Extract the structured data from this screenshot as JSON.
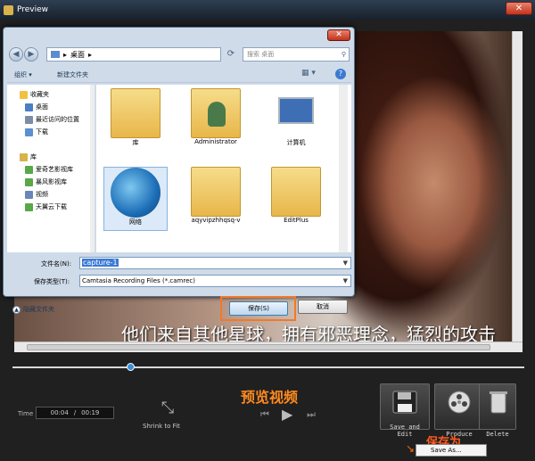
{
  "window": {
    "title": "Preview",
    "close": "✕"
  },
  "video": {
    "subtitle": "他们来自其他星球，拥有邪恶理念，猛烈的攻击"
  },
  "controls": {
    "time_label": "Time",
    "time_current": "00:04",
    "time_sep": "/",
    "time_total": "00:19",
    "shrink_label": "Shrink to Fit",
    "preview_caption": "预览视频",
    "seek_fraction": 0.23
  },
  "actions": {
    "save_edit": "Save and Edit",
    "produce": "Produce",
    "delete": "Delete",
    "save_as_menu": "Save As...",
    "save_as_caption": "保存为"
  },
  "dialog": {
    "address": "桌面",
    "search_placeholder": "搜索 桌面",
    "organize": "组织 ▾",
    "new_folder": "新建文件夹",
    "nav": {
      "favorites": "收藏夹",
      "desktop": "桌面",
      "recent": "最近访问的位置",
      "downloads": "下载",
      "libraries": "库",
      "lib1": "爱奇艺影视库",
      "lib2": "暴风影视库",
      "videos": "视频",
      "tianyi": "天翼云下载"
    },
    "files": {
      "f1": "库",
      "f2": "Administrator",
      "f3": "计算机",
      "f4": "网络",
      "f5": "aqyvipzhhqsq-v",
      "f6": "EditPlus"
    },
    "filename_label": "文件名(N):",
    "filename_value": "capture-1",
    "filetype_label": "保存类型(T):",
    "filetype_value": "Camtasia Recording Files (*.camrec)",
    "hide_folders": "隐藏文件夹",
    "save": "保存(S)",
    "cancel": "取消"
  }
}
